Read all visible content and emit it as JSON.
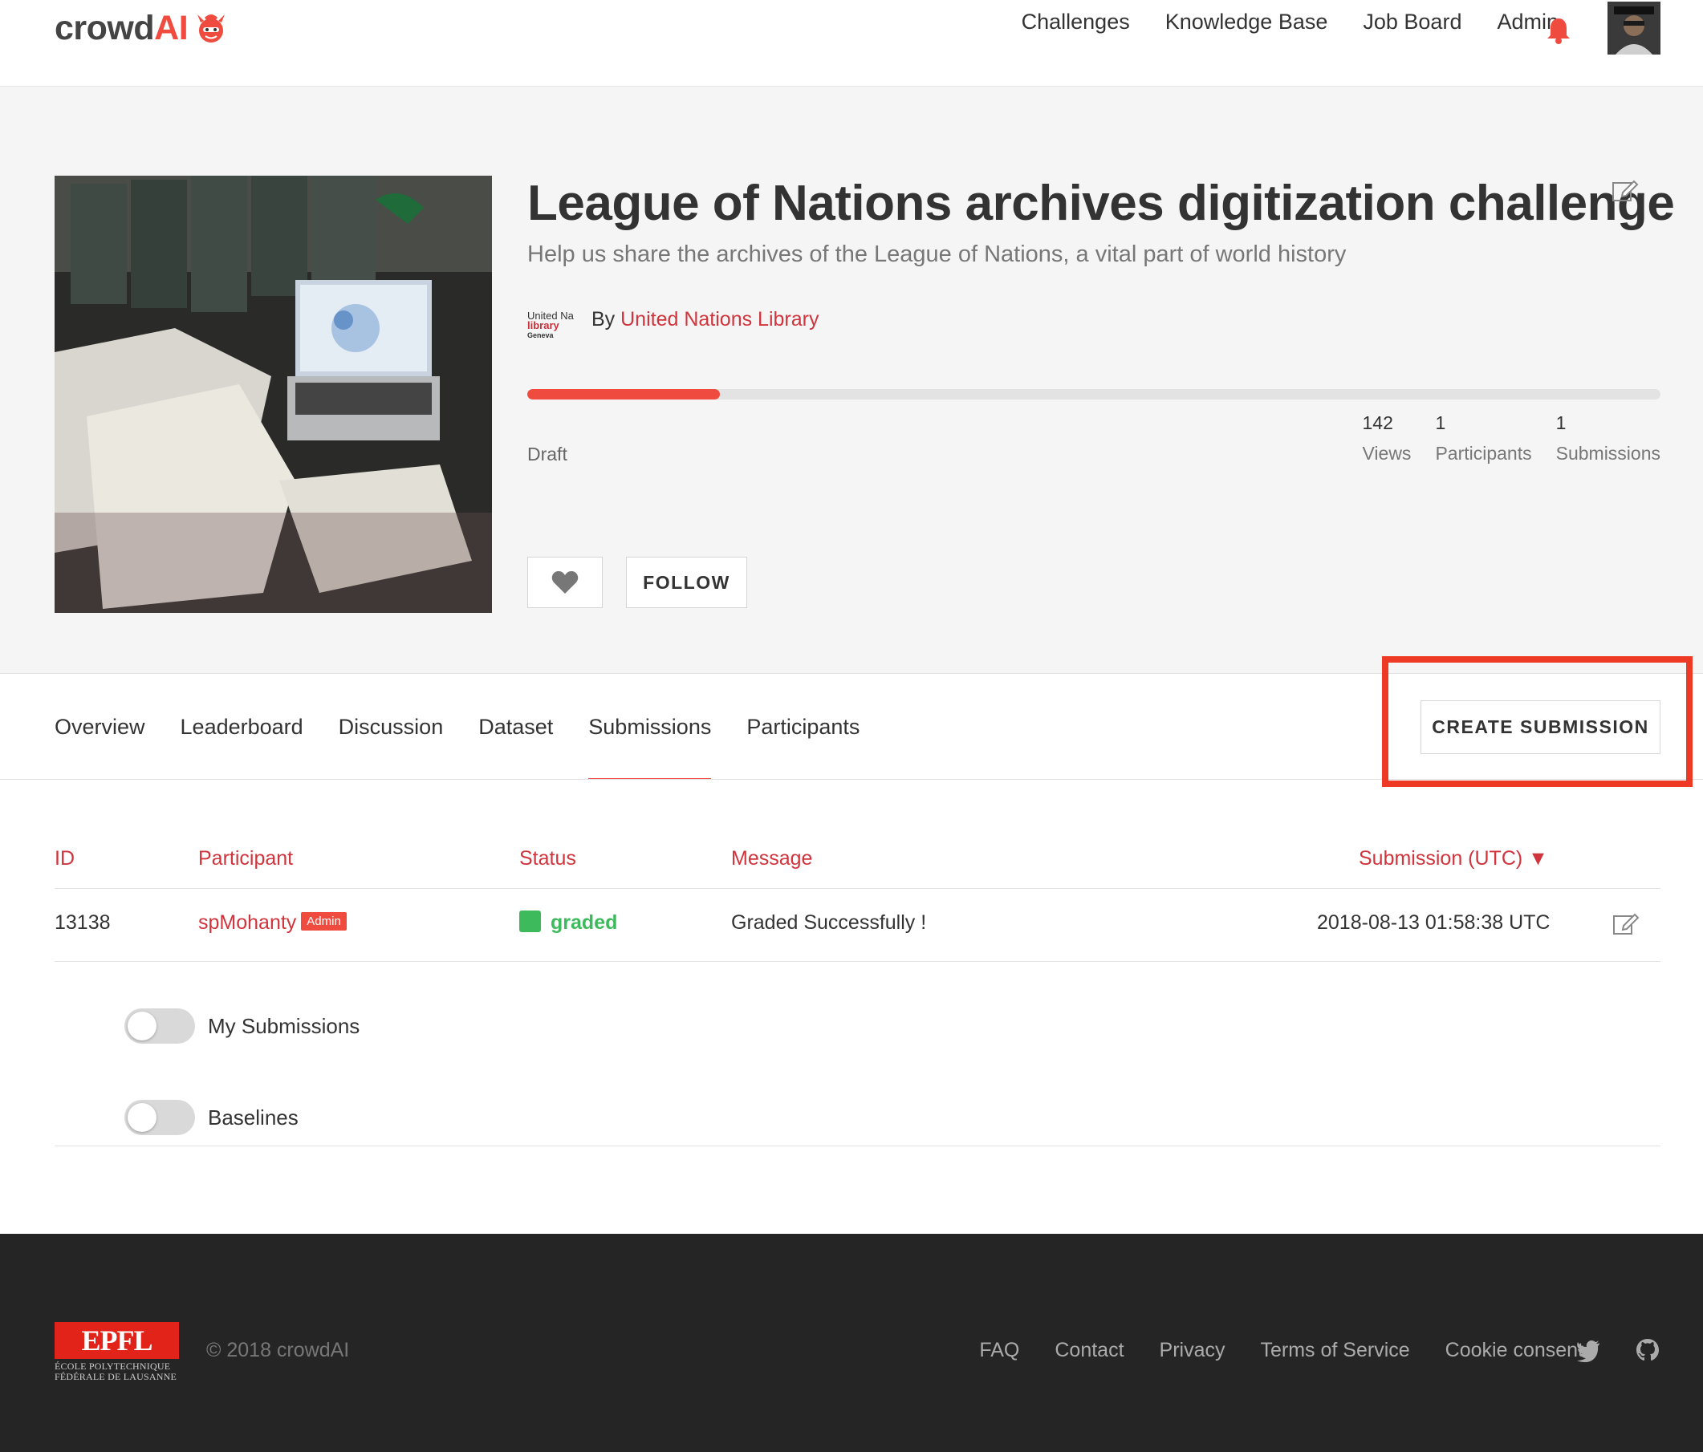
{
  "brand": {
    "logo_crowd": "crowd",
    "logo_ai": "AI",
    "accent_color": "#ef4b3f"
  },
  "nav": {
    "links": [
      "Challenges",
      "Knowledge Base",
      "Job Board",
      "Admin"
    ],
    "bell_icon": "bell-icon",
    "avatar": "user-avatar"
  },
  "challenge": {
    "title": "League of Nations archives digitization challenge",
    "subtitle": "Help us share the archives of the League of Nations, a vital part of world history",
    "org_logo": {
      "line1": "United Na",
      "line2": "library",
      "line3": "Geneva"
    },
    "by_prefix": "By ",
    "organizer": "United Nations Library",
    "progress_fraction": 0.17,
    "status": "Draft",
    "stats": [
      {
        "value": "142",
        "label": "Views"
      },
      {
        "value": "1",
        "label": "Participants"
      },
      {
        "value": "1",
        "label": "Submissions"
      }
    ],
    "follow_label": "FOLLOW"
  },
  "tabs": {
    "items": [
      "Overview",
      "Leaderboard",
      "Discussion",
      "Dataset",
      "Submissions",
      "Participants"
    ],
    "active": "Submissions",
    "create_label": "CREATE SUBMISSION"
  },
  "table": {
    "headers": {
      "id": "ID",
      "participant": "Participant",
      "status": "Status",
      "message": "Message",
      "submission": "Submission (UTC) ▼"
    },
    "rows": [
      {
        "id": "13138",
        "participant": "spMohanty",
        "badge": "Admin",
        "status": "graded",
        "message": "Graded Successfully !",
        "submitted": "2018-08-13 01:58:38 UTC"
      }
    ]
  },
  "toggles": {
    "my_submissions": "My Submissions",
    "baselines": "Baselines"
  },
  "footer": {
    "epfl_mark": "EPFL",
    "epfl_line1": "ÉCOLE POLYTECHNIQUE",
    "epfl_line2": "FÉDÉRALE DE LAUSANNE",
    "copyright": "© 2018 crowdAI",
    "links": [
      "FAQ",
      "Contact",
      "Privacy",
      "Terms of Service",
      "Cookie consent"
    ],
    "social_icons": [
      "twitter-icon",
      "github-icon"
    ]
  }
}
